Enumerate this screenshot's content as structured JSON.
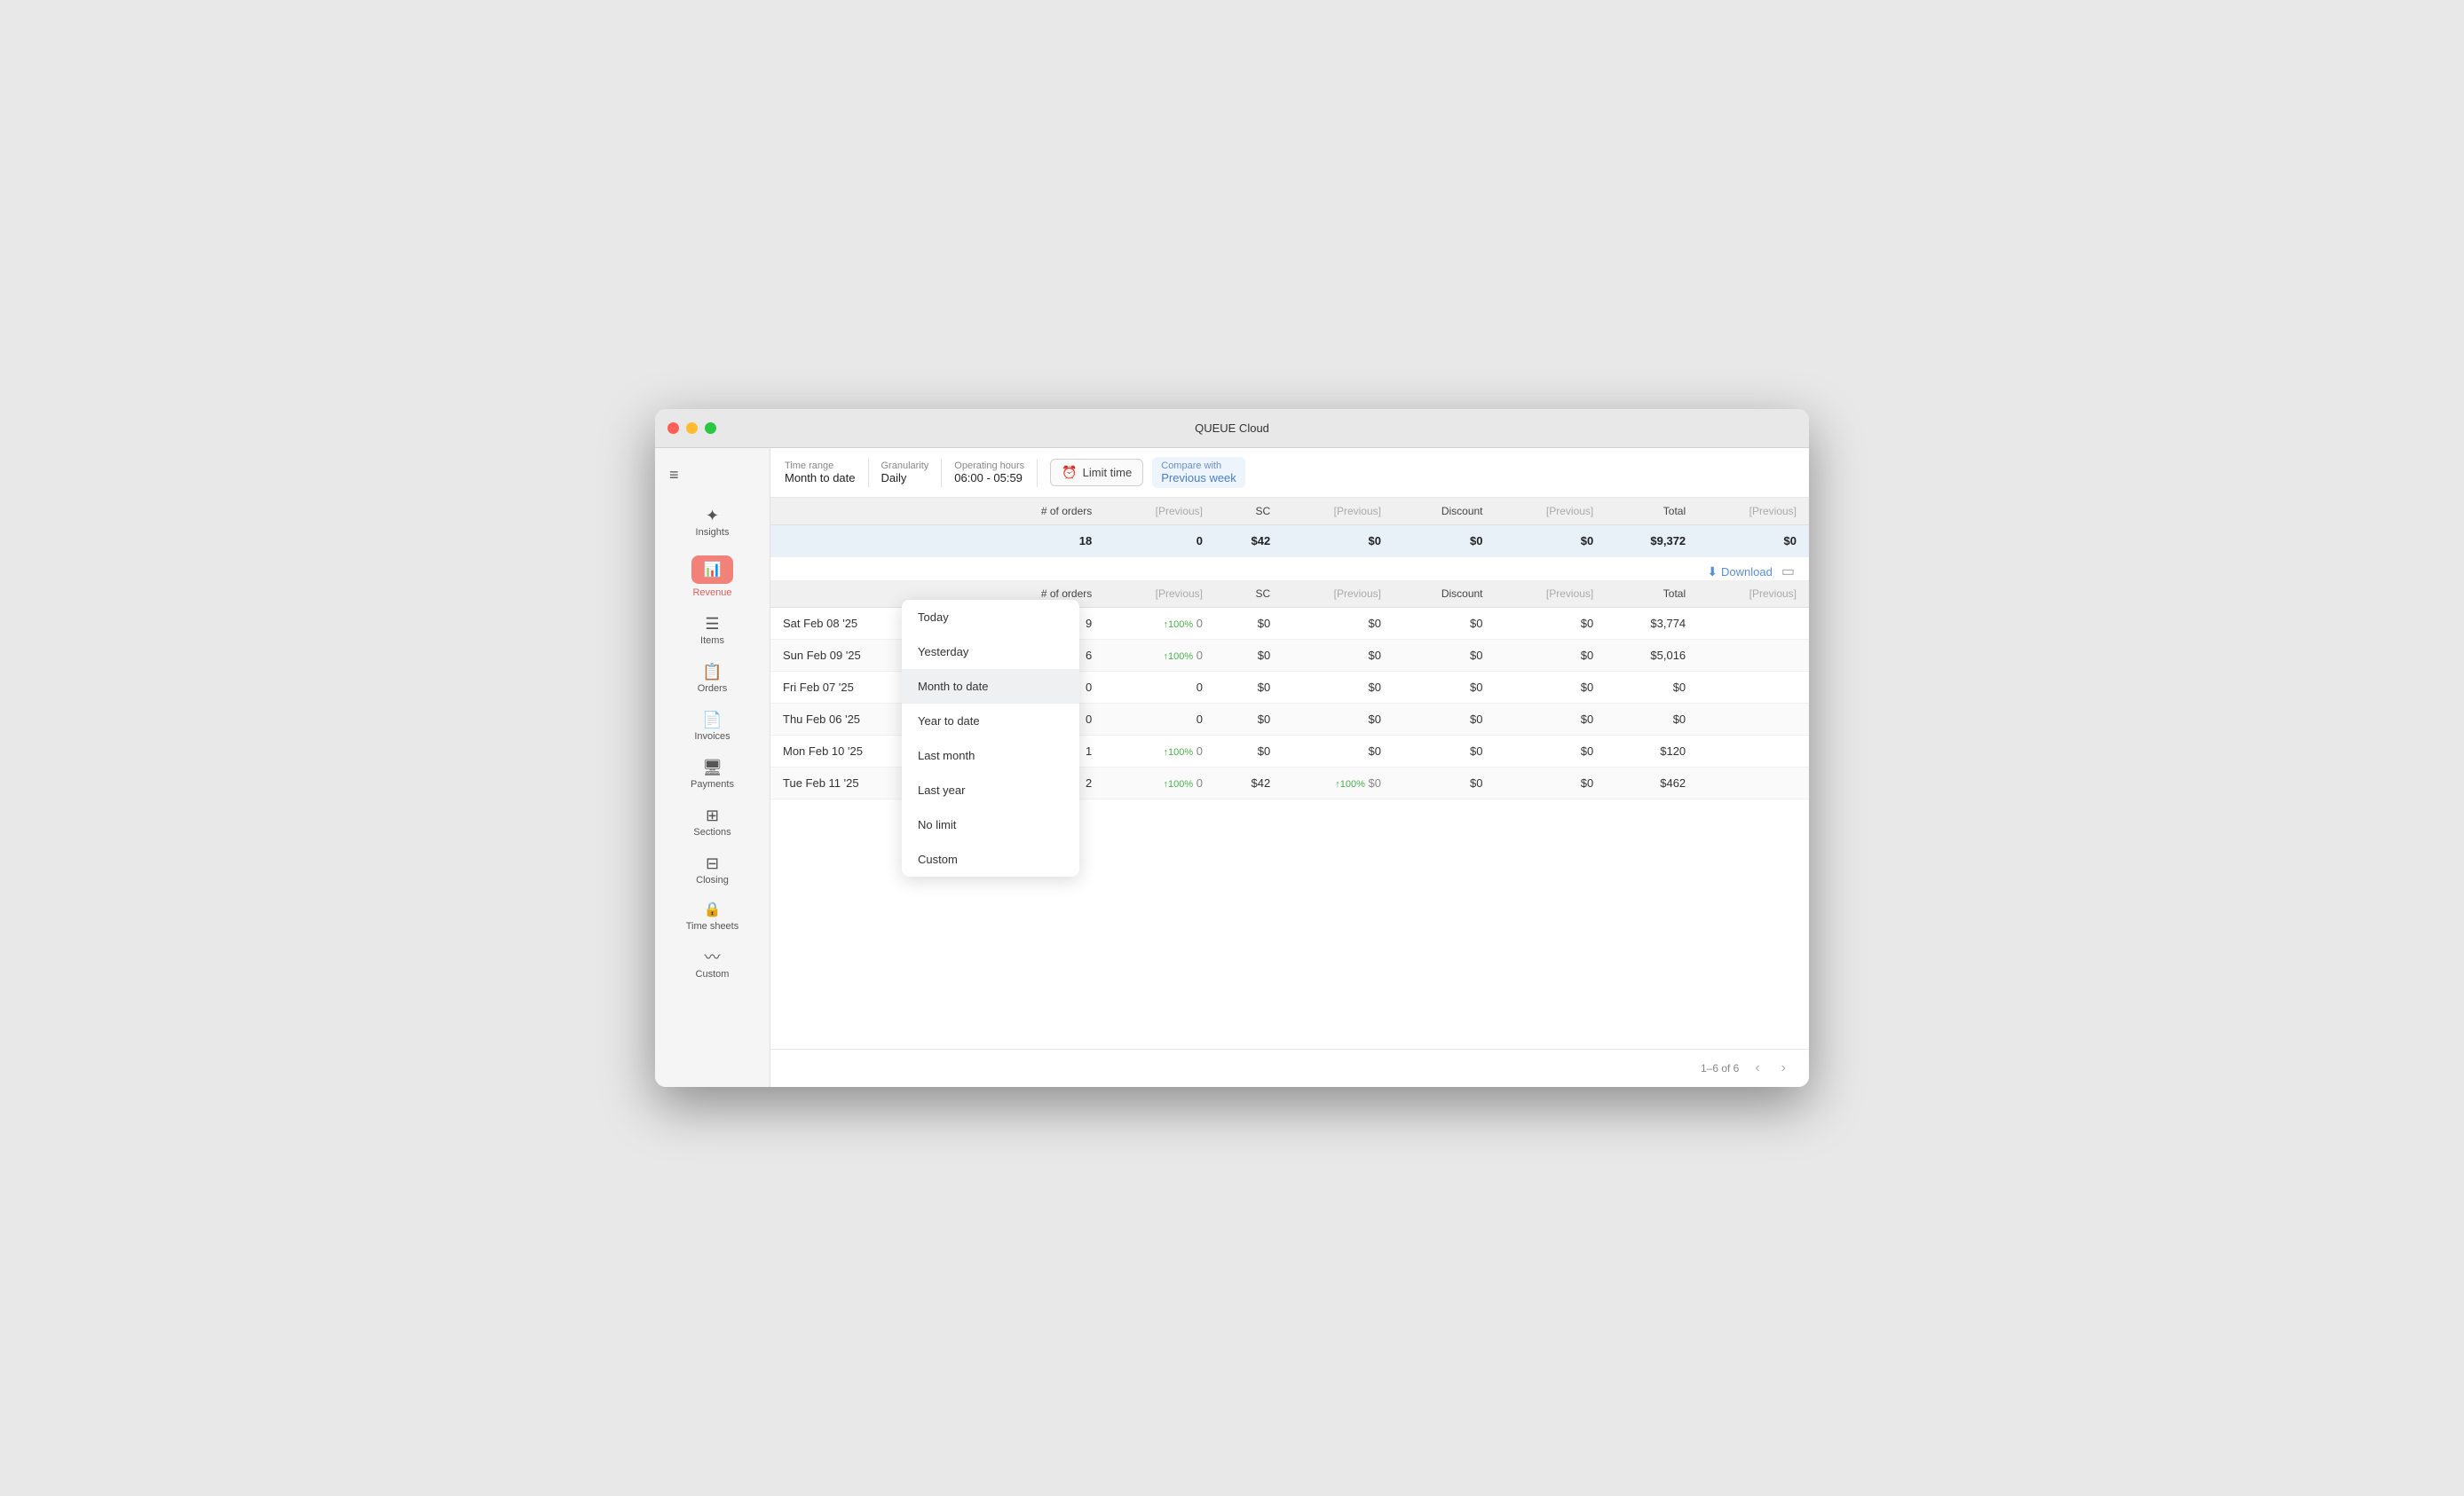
{
  "window": {
    "title": "QUEUE Cloud"
  },
  "toolbar": {
    "time_range_label": "Time range",
    "time_range_value": "Month to date",
    "granularity_label": "Granularity",
    "granularity_value": "Daily",
    "operating_hours_label": "Operating hours",
    "operating_hours_value": "06:00 - 05:59",
    "limit_time_label": "Limit time",
    "compare_label": "Compare with",
    "compare_value": "Previous week"
  },
  "sidebar": {
    "hamburger": "≡",
    "items": [
      {
        "id": "insights",
        "label": "Insights",
        "icon": "✦",
        "active": false
      },
      {
        "id": "revenue",
        "label": "Revenue",
        "icon": "📊",
        "active": true
      },
      {
        "id": "items",
        "label": "Items",
        "icon": "☰",
        "active": false
      },
      {
        "id": "orders",
        "label": "Orders",
        "icon": "📋",
        "active": false
      },
      {
        "id": "invoices",
        "label": "Invoices",
        "icon": "📄",
        "active": false
      },
      {
        "id": "payments",
        "label": "Payments",
        "icon": "🖥",
        "active": false
      },
      {
        "id": "sections",
        "label": "Sections",
        "icon": "⊞",
        "active": false
      },
      {
        "id": "closing",
        "label": "Closing",
        "icon": "⊟",
        "active": false
      },
      {
        "id": "timesheets",
        "label": "Time sheets",
        "icon": "🔒",
        "active": false
      },
      {
        "id": "custom",
        "label": "Custom",
        "icon": "〰",
        "active": false
      }
    ]
  },
  "dropdown": {
    "items": [
      {
        "id": "today",
        "label": "Today",
        "active": false
      },
      {
        "id": "yesterday",
        "label": "Yesterday",
        "active": false
      },
      {
        "id": "month_to_date",
        "label": "Month to date",
        "active": true
      },
      {
        "id": "year_to_date",
        "label": "Year to date",
        "active": false
      },
      {
        "id": "last_month",
        "label": "Last month",
        "active": false
      },
      {
        "id": "last_year",
        "label": "Last year",
        "active": false
      },
      {
        "id": "no_limit",
        "label": "No limit",
        "active": false
      },
      {
        "id": "custom",
        "label": "Custom",
        "active": false
      }
    ]
  },
  "summary_row": {
    "label": "",
    "orders": "18",
    "previous_orders": "0",
    "sc": "$42",
    "previous_sc": "$0",
    "discount": "$0",
    "previous_discount": "$0",
    "total": "$9,372",
    "previous_total": "$0"
  },
  "table": {
    "columns": [
      {
        "id": "date",
        "label": ""
      },
      {
        "id": "orders",
        "label": "# of orders"
      },
      {
        "id": "prev_orders",
        "label": "[Previous]"
      },
      {
        "id": "sc",
        "label": "SC"
      },
      {
        "id": "prev_sc",
        "label": "[Previous]"
      },
      {
        "id": "discount",
        "label": "Discount"
      },
      {
        "id": "prev_discount",
        "label": "[Previous]"
      },
      {
        "id": "total",
        "label": "Total"
      },
      {
        "id": "prev_total",
        "label": "[Previous]"
      }
    ],
    "rows": [
      {
        "date": "Sat Feb 08 '25",
        "orders": "9",
        "prev_orders_arrow": "↑100%",
        "prev_orders": "0",
        "sc": "$0",
        "prev_sc": "$0",
        "discount": "$0",
        "prev_discount": "$0",
        "total": "$3,774",
        "prev_total": ""
      },
      {
        "date": "Sun Feb 09 '25",
        "orders": "6",
        "prev_orders_arrow": "↑100%",
        "prev_orders": "0",
        "sc": "$0",
        "prev_sc": "$0",
        "discount": "$0",
        "prev_discount": "$0",
        "total": "$5,016",
        "prev_total": ""
      },
      {
        "date": "Fri Feb 07 '25",
        "orders": "0",
        "prev_orders_arrow": "",
        "prev_orders": "0",
        "sc": "$0",
        "prev_sc": "$0",
        "discount": "$0",
        "prev_discount": "$0",
        "total": "$0",
        "prev_total": ""
      },
      {
        "date": "Thu Feb 06 '25",
        "orders": "0",
        "prev_orders_arrow": "",
        "prev_orders": "0",
        "sc": "$0",
        "prev_sc": "$0",
        "discount": "$0",
        "prev_discount": "$0",
        "total": "$0",
        "prev_total": ""
      },
      {
        "date": "Mon Feb 10 '25",
        "orders": "1",
        "prev_orders_arrow": "↑100%",
        "prev_orders": "0",
        "sc": "$0",
        "prev_sc": "$0",
        "discount": "$0",
        "prev_discount": "$0",
        "total": "$120",
        "prev_total": ""
      },
      {
        "date": "Tue Feb 11 '25",
        "orders": "2",
        "prev_orders_arrow": "↑100%",
        "prev_orders": "0",
        "sc": "$42",
        "prev_sc_arrow": "↑100%",
        "prev_sc": "$0",
        "discount": "$0",
        "prev_discount": "$0",
        "total": "$462",
        "prev_total": ""
      }
    ],
    "pagination": "1–6 of 6"
  },
  "actions": {
    "download": "Download"
  }
}
